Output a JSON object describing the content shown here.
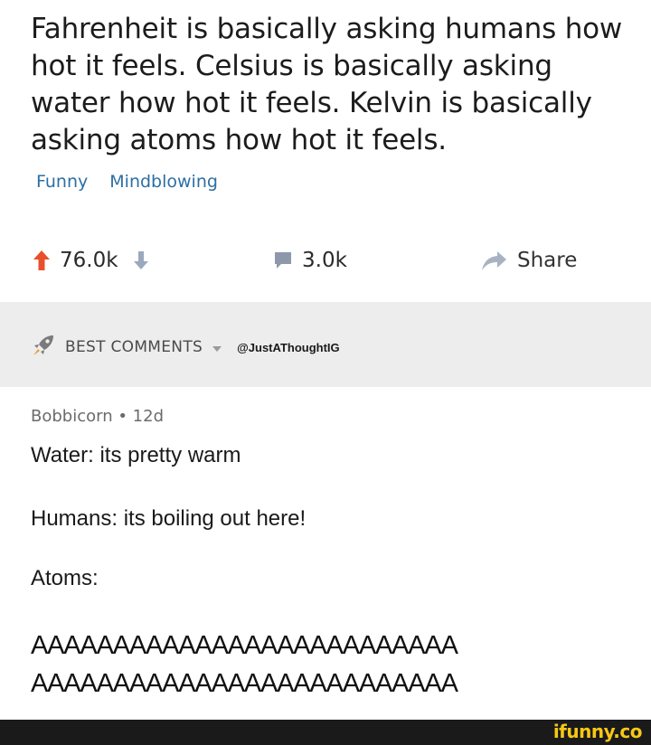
{
  "post": {
    "title": "Fahrenheit is basically asking humans how hot it feels. Celsius is basically asking water how hot it feels. Kelvin is basically asking atoms how hot it feels.",
    "tags": [
      "Funny",
      "Mindblowing"
    ]
  },
  "actions": {
    "upvotes": "76.0k",
    "comments": "3.0k",
    "share": "Share"
  },
  "best_comments": {
    "label": "BEST COMMENTS",
    "handle": "@JustAThoughtIG"
  },
  "comment": {
    "author_meta": "Bobbicorn • 12d",
    "line1": "Water: its pretty warm",
    "line2": "Humans: its boiling out here!",
    "line3": "Atoms:",
    "scream1": "AAAAAAAAAAAAAAAAAAAAAAAAAA",
    "scream2": "AAAAAAAAAAAAAAAAAAAAAAAAAA"
  },
  "footer": {
    "logo": "ifunny.co"
  },
  "colors": {
    "upvote": "#e8502c",
    "downvote": "#9aa9bd",
    "tag": "#2d6fa3",
    "bar_bg": "#ededed",
    "footer_bg": "#1a1a1a",
    "logo": "#f7c715"
  }
}
